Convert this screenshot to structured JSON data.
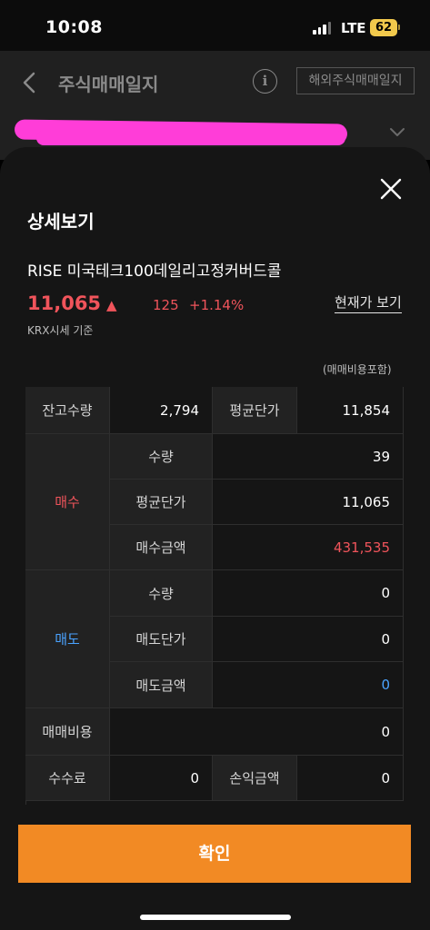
{
  "status": {
    "time": "10:08",
    "network": "LTE",
    "battery": "62"
  },
  "header": {
    "title": "주식매매일지",
    "info_icon": "info-circle-icon",
    "overseas_button": "해외주식매매일지"
  },
  "sheet": {
    "title": "상세보기",
    "stock_name": "RISE 미국테크100데일리고정커버드콜",
    "price": "11,065",
    "arrow": "▲",
    "change": "125",
    "change_pct": "+1.14%",
    "current_price_link": "현재가 보기",
    "basis": "KRX시세 기준",
    "fee_note": "(매매비용포함)"
  },
  "table": {
    "holding_qty_label": "잔고수량",
    "holding_qty": "2,794",
    "avg_price_label": "평균단가",
    "avg_price": "11,854",
    "buy": {
      "label": "매수",
      "qty_label": "수량",
      "qty": "39",
      "avg_label": "평균단가",
      "avg": "11,065",
      "amount_label": "매수금액",
      "amount": "431,535"
    },
    "sell": {
      "label": "매도",
      "qty_label": "수량",
      "qty": "0",
      "price_label": "매도단가",
      "price": "0",
      "amount_label": "매도금액",
      "amount": "0"
    },
    "trade_cost_label": "매매비용",
    "trade_cost": "0",
    "commission_label": "수수료",
    "commission": "0",
    "pnl_label": "손익금액",
    "pnl": "0"
  },
  "confirm_label": "확인",
  "colors": {
    "accent": "#f28a24",
    "up": "#f0545b",
    "down": "#4aa3ff",
    "mask": "#ff3dd8"
  }
}
